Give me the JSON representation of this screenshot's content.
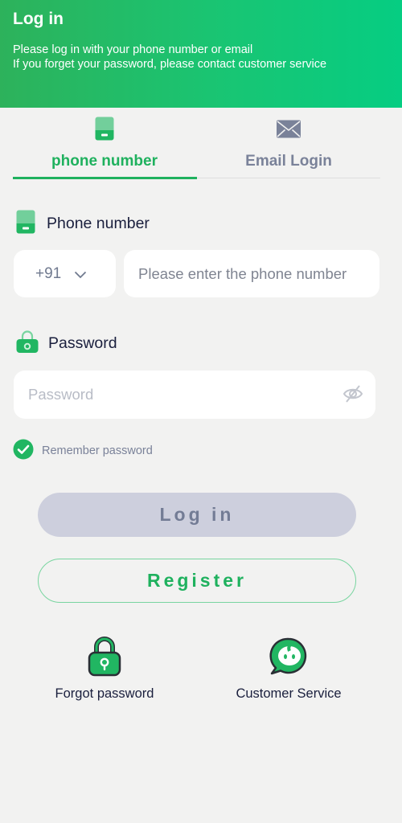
{
  "header": {
    "title": "Log in",
    "subtitle_line1": "Please log in with your phone number or email",
    "subtitle_line2": "If you forget your password, please contact customer service"
  },
  "tabs": [
    {
      "label": "phone number",
      "icon": "phone-icon",
      "active": true
    },
    {
      "label": "Email Login",
      "icon": "envelope-icon",
      "active": false
    }
  ],
  "phone_field": {
    "label": "Phone number",
    "country_code": "+91",
    "placeholder": "Please enter the phone number",
    "value": ""
  },
  "password_field": {
    "label": "Password",
    "placeholder": "Password",
    "value": ""
  },
  "remember": {
    "label": "Remember password",
    "checked": true
  },
  "buttons": {
    "login": "Log in",
    "register": "Register"
  },
  "links": [
    {
      "label": "Forgot password",
      "icon": "lock-icon"
    },
    {
      "label": "Customer Service",
      "icon": "chat-bubble-icon"
    }
  ],
  "colors": {
    "brand_green": "#1fb15e",
    "header_gradient_start": "#2db25b",
    "header_gradient_end": "#06cd82",
    "login_button_bg": "#cdcfdd",
    "muted_text": "#7a8299"
  }
}
